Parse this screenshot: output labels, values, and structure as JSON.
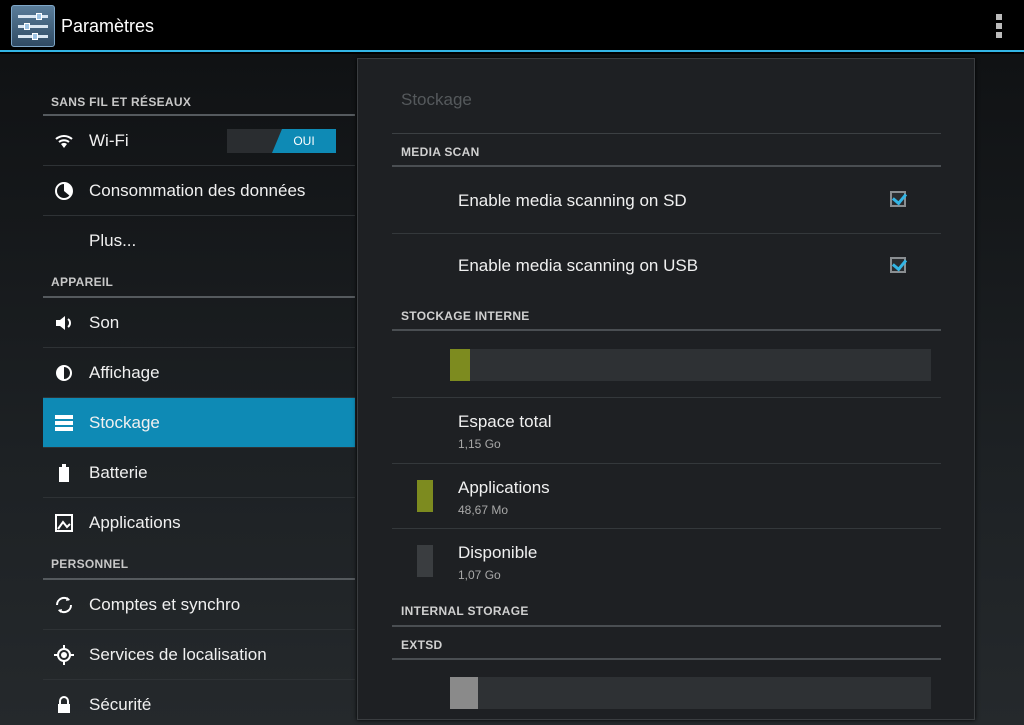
{
  "actionbar": {
    "title": "Paramètres",
    "app_icon": "settings-icon",
    "overflow_icon": "overflow-menu-icon"
  },
  "sidebar": {
    "sections": [
      {
        "label": "SANS FIL ET RÉSEAUX"
      },
      {
        "label": "APPAREIL"
      },
      {
        "label": "PERSONNEL"
      }
    ],
    "items": [
      {
        "label": "Wi-Fi",
        "icon": "wifi-icon",
        "toggle": "OUI"
      },
      {
        "label": "Consommation des données",
        "icon": "data-usage-icon"
      },
      {
        "label": "Plus..."
      },
      {
        "label": "Son",
        "icon": "sound-icon"
      },
      {
        "label": "Affichage",
        "icon": "display-icon"
      },
      {
        "label": "Stockage",
        "icon": "storage-icon",
        "selected": true
      },
      {
        "label": "Batterie",
        "icon": "battery-icon"
      },
      {
        "label": "Applications",
        "icon": "apps-icon"
      },
      {
        "label": "Comptes et synchro",
        "icon": "sync-icon"
      },
      {
        "label": "Services de localisation",
        "icon": "location-icon"
      },
      {
        "label": "Sécurité",
        "icon": "lock-icon"
      }
    ]
  },
  "details": {
    "title": "Stockage",
    "media_scan": {
      "header": "MEDIA SCAN",
      "sd_label": "Enable media scanning on SD",
      "sd_checked": true,
      "usb_label": "Enable media scanning on USB",
      "usb_checked": true
    },
    "internal": {
      "header": "STOCKAGE INTERNE",
      "apps_fraction": 0.042,
      "total_label": "Espace total",
      "total_value": "1,15 Go",
      "apps_label": "Applications",
      "apps_value": "48,67 Mo",
      "free_label": "Disponible",
      "free_value": "1,07 Go"
    },
    "internal_storage_header": "INTERNAL STORAGE",
    "extsd": {
      "header": "EXTSD",
      "used_fraction": 0.058
    }
  },
  "colors": {
    "accent": "#33b5e5",
    "selected": "#0e8ab5",
    "apps_bar": "#7d8b1f",
    "free_swatch": "#3a3d40",
    "extsd_bar": "#8a8a8a"
  }
}
